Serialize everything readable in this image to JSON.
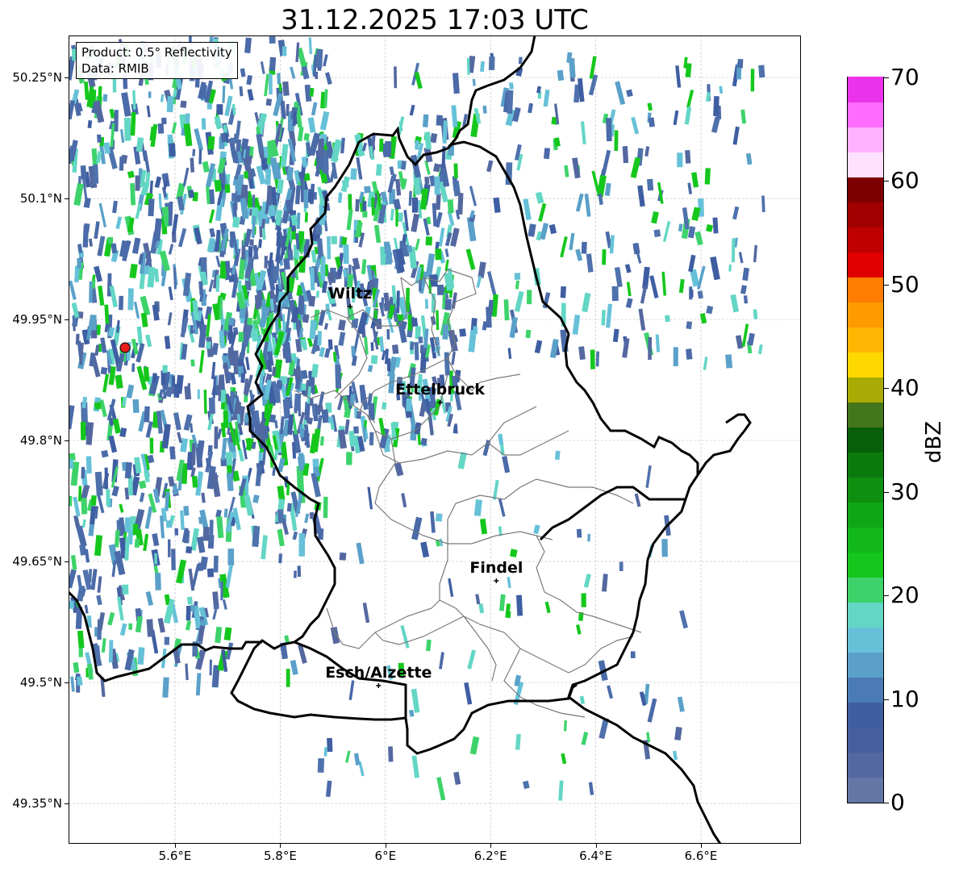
{
  "title": "31.12.2025 17:03 UTC",
  "info": {
    "product": "Product: 0.5° Reflectivity",
    "data_source": "Data: RMIB"
  },
  "lat_ticks": [
    "50.25°N",
    "50.1°N",
    "49.95°N",
    "49.8°N",
    "49.65°N",
    "49.5°N",
    "49.35°N"
  ],
  "lon_ticks": [
    "5.6°E",
    "5.8°E",
    "6°E",
    "6.2°E",
    "6.4°E",
    "6.6°E"
  ],
  "cities": [
    {
      "name": "Wiltz",
      "lat": 49.966,
      "lon": 5.933
    },
    {
      "name": "Ettelbruck",
      "lat": 49.847,
      "lon": 6.104
    },
    {
      "name": "Findel",
      "lat": 49.626,
      "lon": 6.211
    },
    {
      "name": "Esch/Alzette",
      "lat": 49.496,
      "lon": 5.987
    }
  ],
  "radar_site": {
    "lat": 49.915,
    "lon": 5.505,
    "color": "#e8201b"
  },
  "colorbar": {
    "label": "dBZ",
    "ticks": [
      "0",
      "10",
      "20",
      "30",
      "40",
      "50",
      "60",
      "70"
    ],
    "min": 0,
    "max": 70,
    "step": 2.5,
    "colors": [
      "#6476a6",
      "#5468a0",
      "#475e9d",
      "#3f5ea2",
      "#4b7bb5",
      "#5aa0c9",
      "#66c1d8",
      "#63d6c5",
      "#3dd36a",
      "#15c71d",
      "#12b81a",
      "#10a515",
      "#0e8f10",
      "#0b7a0d",
      "#075f0a",
      "#44761b",
      "#aaaa05",
      "#ffd800",
      "#ffb703",
      "#ff9a00",
      "#ff7d00",
      "#e00000",
      "#be0000",
      "#a10000",
      "#7d0000",
      "#ffe0ff",
      "#ffb2ff",
      "#ff6cff",
      "#ec33ec"
    ]
  },
  "map_style": {
    "country_border": "#000000",
    "canton_border": "#7a7a7a",
    "grid": "#bbbbbb"
  }
}
